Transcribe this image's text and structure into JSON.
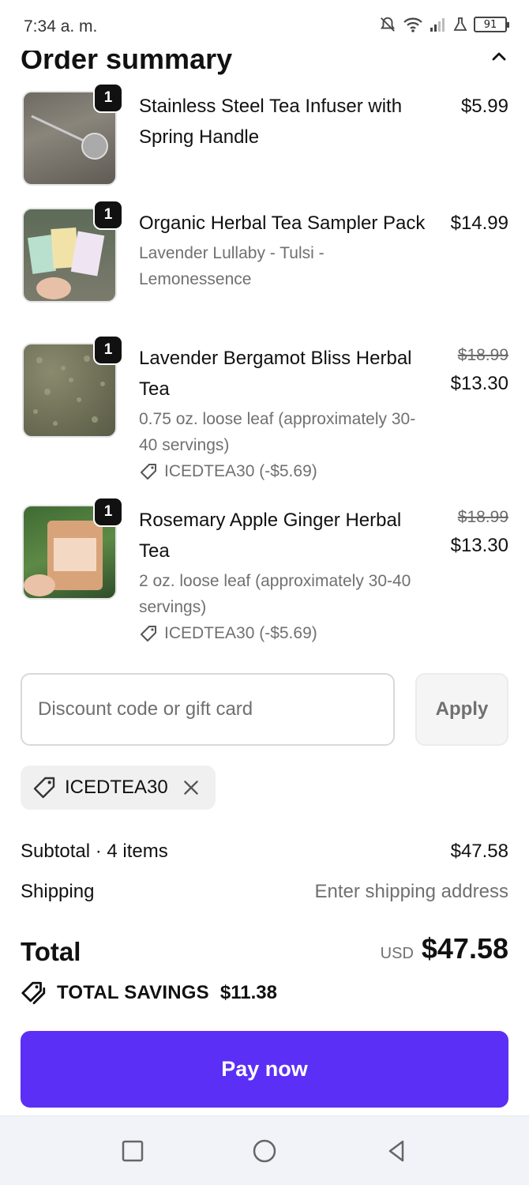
{
  "status_bar": {
    "time": "7:34 a. m.",
    "battery": "91"
  },
  "header": {
    "title": "Order summary",
    "collapse_icon": "chevron-up-icon"
  },
  "items": [
    {
      "quantity": "1",
      "name": "Stainless Steel Tea Infuser with Spring Handle",
      "variant": "",
      "discount": "",
      "price_original": "",
      "price": "$5.99"
    },
    {
      "quantity": "1",
      "name": "Organic Herbal Tea Sampler Pack",
      "variant": "Lavender Lullaby - Tulsi - Lemonessence",
      "discount": "",
      "price_original": "",
      "price": "$14.99"
    },
    {
      "quantity": "1",
      "name": "Lavender Bergamot Bliss Herbal Tea",
      "variant": "0.75 oz. loose leaf (approximately 30-40 servings)",
      "discount": "ICEDTEA30 (-$5.69)",
      "price_original": "$18.99",
      "price": "$13.30"
    },
    {
      "quantity": "1",
      "name": "Rosemary Apple Ginger Herbal Tea",
      "variant": "2 oz. loose leaf (approximately 30-40 servings)",
      "discount": "ICEDTEA30 (-$5.69)",
      "price_original": "$18.99",
      "price": "$13.30"
    }
  ],
  "discount": {
    "placeholder": "Discount code or gift card",
    "apply_label": "Apply",
    "applied_code": "ICEDTEA30"
  },
  "summary": {
    "subtotal_label": "Subtotal · 4 items",
    "subtotal_value": "$47.58",
    "shipping_label": "Shipping",
    "shipping_value": "Enter shipping address",
    "total_label": "Total",
    "currency": "USD",
    "total_value": "$47.58",
    "savings_label": "TOTAL SAVINGS",
    "savings_value": "$11.38"
  },
  "pay_button": "Pay now",
  "colors": {
    "accent": "#5b2ff5",
    "muted_text": "#707070"
  }
}
